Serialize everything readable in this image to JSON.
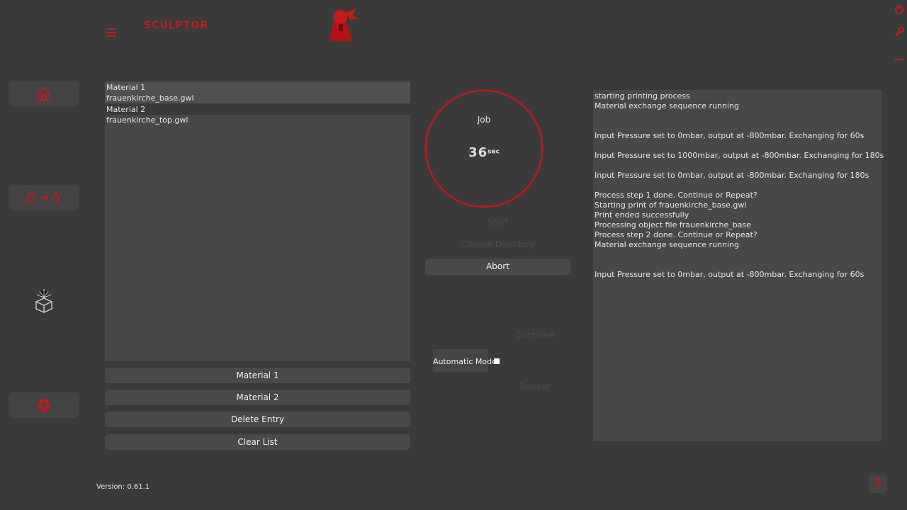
{
  "app": {
    "title": "SCULPTOR",
    "version": "Version: 0.61.1",
    "accent": "#c41a1a"
  },
  "icons": {
    "menu": "menu-icon",
    "logo": "bust-logo-icon",
    "home": "home-icon",
    "exchange": "drop-exchange-icon",
    "printer": "printer-cube-icon",
    "settings": "aperture-icon",
    "power": "power-icon",
    "wrench": "wrench-icon",
    "minimize": "minimize-icon",
    "help": "help-icon"
  },
  "material_list": [
    {
      "label": "Material 1",
      "file": "frauenkirche_base.gwl"
    },
    {
      "label": "Material 2",
      "file": "frauenkirche_top.gwl"
    }
  ],
  "buttons": {
    "material1": "Material 1",
    "material2": "Material 2",
    "delete": "Delete Entry",
    "clear": "Clear List"
  },
  "job": {
    "label": "Job",
    "value": "36",
    "unit": "sec"
  },
  "controls": {
    "start": "Start",
    "choose_directory": "Choose Directory",
    "abort": "Abort",
    "continue": "Continue",
    "repeat": "Repeat",
    "automatic_mode": "Automatic Mode"
  },
  "log": [
    "starting printing process",
    "Material exchange sequence running",
    "",
    "",
    "Input Pressure set to 0mbar, output at -800mbar. Exchanging for 60s",
    "",
    "Input Pressure set to 1000mbar, output at -800mbar. Exchanging for 180s",
    "",
    "Input Pressure set to 0mbar, output at -800mbar. Exchanging for 180s",
    "",
    "Process step 1 done. Continue or Repeat?",
    "Starting print of frauenkirche_base.gwl",
    "Print ended successfully",
    "Processing object file frauenkirche_base",
    "Process step 2 done. Continue or Repeat?",
    "Material exchange sequence running",
    "",
    "",
    "Input Pressure set to 0mbar, output at -800mbar. Exchanging for 60s"
  ]
}
